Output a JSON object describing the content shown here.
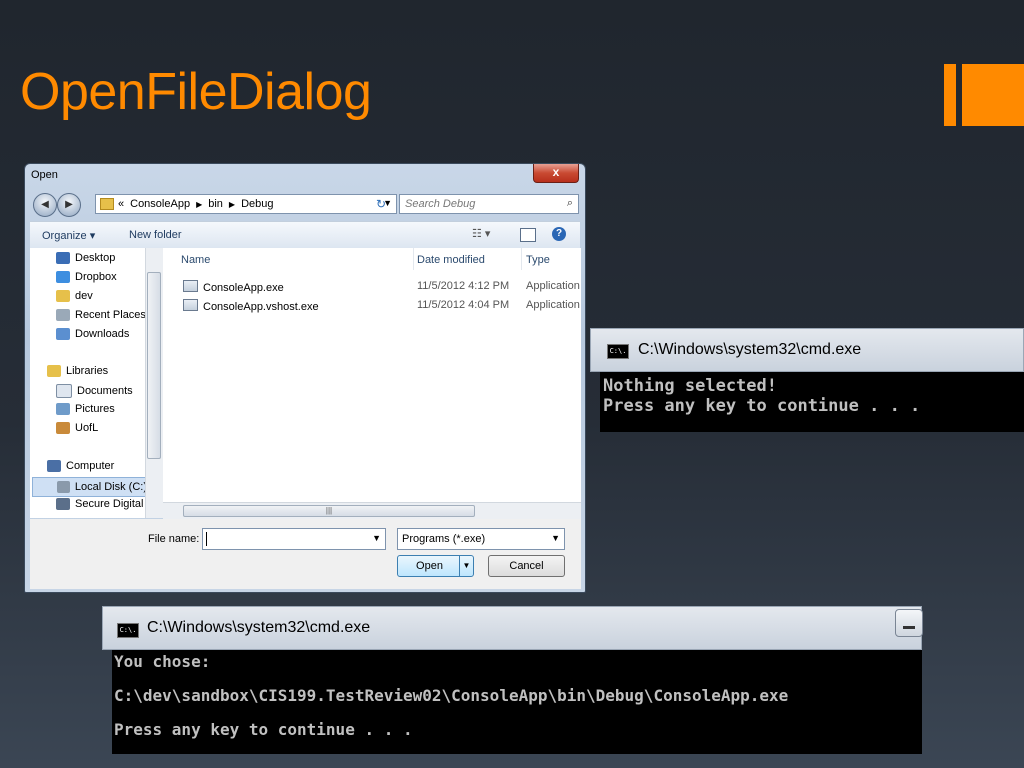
{
  "slide": {
    "title": "OpenFileDialog",
    "accent_color": "#ff8a00"
  },
  "dialog": {
    "title": "Open",
    "close_label": "x",
    "address": {
      "prefix": "«",
      "crumbs": [
        "ConsoleApp",
        "bin",
        "Debug"
      ]
    },
    "search_placeholder": "Search Debug",
    "toolbar": {
      "organize": "Organize ▾",
      "new_folder": "New folder"
    },
    "nav": {
      "items": [
        {
          "label": "Desktop",
          "icon": "desktop-icon"
        },
        {
          "label": "Dropbox",
          "icon": "dropbox-icon"
        },
        {
          "label": "dev",
          "icon": "folder-icon"
        },
        {
          "label": "Recent Places",
          "icon": "recent-places-icon"
        },
        {
          "label": "Downloads",
          "icon": "downloads-icon"
        },
        {
          "label": "Libraries",
          "icon": "libraries-icon"
        },
        {
          "label": "Documents",
          "icon": "documents-icon"
        },
        {
          "label": "Pictures",
          "icon": "pictures-icon"
        },
        {
          "label": "UofL",
          "icon": "user-icon"
        },
        {
          "label": "Computer",
          "icon": "computer-icon"
        },
        {
          "label": "Local Disk (C:)",
          "icon": "disk-icon"
        },
        {
          "label": "Secure Digital S",
          "icon": "sd-card-icon"
        }
      ],
      "selected": "Local Disk (C:)"
    },
    "files": {
      "columns": [
        "Name",
        "Date modified",
        "Type"
      ],
      "rows": [
        {
          "name": "ConsoleApp.exe",
          "date": "11/5/2012 4:12 PM",
          "type": "Application"
        },
        {
          "name": "ConsoleApp.vshost.exe",
          "date": "11/5/2012 4:04 PM",
          "type": "Application"
        }
      ]
    },
    "filename_label": "File name:",
    "filename_value": "",
    "filetype": "Programs (*.exe)",
    "open_label": "Open",
    "cancel_label": "Cancel"
  },
  "console1": {
    "title": "C:\\Windows\\system32\\cmd.exe",
    "icon_text": "C:\\.",
    "lines": [
      "Nothing selected!",
      "Press any key to continue . . ."
    ]
  },
  "console2": {
    "title": "C:\\Windows\\system32\\cmd.exe",
    "icon_text": "C:\\.",
    "lines": [
      "You chose:",
      "C:\\dev\\sandbox\\CIS199.TestReview02\\ConsoleApp\\bin\\Debug\\ConsoleApp.exe",
      "Press any key to continue . . ."
    ]
  }
}
